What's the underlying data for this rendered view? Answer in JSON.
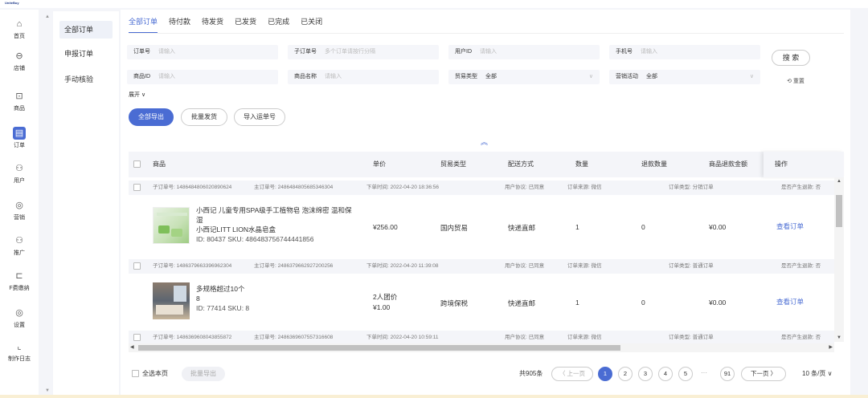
{
  "app": {
    "logo": "UniteBuy"
  },
  "leftnav": [
    {
      "label": "首页",
      "icon": "home-icon",
      "glyph": "⌂"
    },
    {
      "label": "店铺",
      "icon": "store-icon",
      "glyph": "⊖"
    },
    {
      "label": "商品",
      "icon": "goods-icon",
      "glyph": "⊡"
    },
    {
      "label": "订单",
      "icon": "order-icon",
      "glyph": "▤"
    },
    {
      "label": "用户",
      "icon": "user-icon",
      "glyph": "⚇"
    },
    {
      "label": "营销",
      "icon": "marketing-icon",
      "glyph": "◎"
    },
    {
      "label": "推广",
      "icon": "promote-icon",
      "glyph": "⚇"
    },
    {
      "label": "F费缴纳",
      "icon": "fee-icon",
      "glyph": "⊏"
    },
    {
      "label": "设置",
      "icon": "settings-icon",
      "glyph": "◎"
    },
    {
      "label": "制作日志",
      "icon": "log-icon",
      "glyph": "⌞"
    }
  ],
  "subnav": [
    "全部订单",
    "申报订单",
    "手动核验"
  ],
  "tabs": [
    "全部订单",
    "待付款",
    "待发货",
    "已发货",
    "已完成",
    "已关闭"
  ],
  "filters": {
    "order_no": {
      "label": "订单号",
      "placeholder": "请输入"
    },
    "sub_order_no": {
      "label": "子订单号",
      "placeholder": "多个订单请按行分隔"
    },
    "user_id": {
      "label": "用户ID",
      "placeholder": "请输入"
    },
    "phone": {
      "label": "手机号",
      "placeholder": "请输入"
    },
    "goods_id": {
      "label": "商品ID",
      "placeholder": "请输入"
    },
    "goods_name": {
      "label": "商品名称",
      "placeholder": "请输入"
    },
    "trade_type": {
      "label": "贸易类型",
      "value": "全部"
    },
    "marketing": {
      "label": "营销活动",
      "value": "全部"
    },
    "search": "搜 索",
    "reset": "⟲ 重置",
    "expand": "展开 ∨"
  },
  "actions": {
    "export_all": "全部导出",
    "batch_ship": "批量发货",
    "import_waybill": "导入运单号"
  },
  "table": {
    "headers": {
      "goods": "商品",
      "price": "单价",
      "trade": "贸易类型",
      "ship": "配送方式",
      "qty": "数量",
      "refund_qty": "退款数量",
      "refund_amt": "商品退款金额",
      "op": "操作"
    },
    "orders": [
      {
        "sub_no": "子订单号: 1486484806020890624",
        "main_no": "主订单号: 2486484805685346304",
        "time": "下单时间: 2022-04-20 18:36:56",
        "agreement": "用户协议: 已同意",
        "source": "订单来源: 微信",
        "otype": "订单类型: 分销订单",
        "refund_flag": "是否产生退款: 否",
        "name": "小西记 儿童专用SPA级手工植物皂 泡沫绵密 温和保湿",
        "spec": "小西记LITT LION水晶皂盒",
        "ids": "ID: 80437  SKU: 486483756744441856",
        "price_line1": "¥256.00",
        "price_line2": "",
        "trade": "国内贸易",
        "ship": "快递直邮",
        "qty": "1",
        "refund_qty": "0",
        "refund_amt": "¥0.00",
        "op": "查看订单"
      },
      {
        "sub_no": "子订单号: 1486379663396962304",
        "main_no": "主订单号: 2486379662927200256",
        "time": "下单时间: 2022-04-20 11:39:08",
        "agreement": "用户协议: 已同意",
        "source": "订单来源: 微信",
        "otype": "订单类型: 普通订单",
        "refund_flag": "是否产生退款: 否",
        "name": "多规格超过10个",
        "spec": "8",
        "ids": "ID: 77414  SKU: 8",
        "price_line1": "2人团价",
        "price_line2": "¥1.00",
        "trade": "跨境保税",
        "ship": "快递直邮",
        "qty": "1",
        "refund_qty": "0",
        "refund_amt": "¥0.00",
        "op": "查看订单"
      },
      {
        "sub_no": "子订单号: 1486369608043855872",
        "main_no": "主订单号: 2486369607557316608",
        "time": "下单时间: 2022-04-20 10:59:11",
        "agreement": "用户协议: 已同意",
        "source": "订单来源: 微信",
        "otype": "订单类型: 普通订单",
        "refund_flag": "是否产生退款: 否"
      }
    ]
  },
  "footer": {
    "select_page": "全选本页",
    "batch_export": "批量导出",
    "total": "共905条",
    "prev": "〈 上一页",
    "pages": [
      "1",
      "2",
      "3",
      "4",
      "5"
    ],
    "ellipsis": "···",
    "last": "91",
    "next": "下一页 〉",
    "page_size": "10 条/页 ∨"
  },
  "colors": {
    "accent": "#4a6cd3"
  }
}
